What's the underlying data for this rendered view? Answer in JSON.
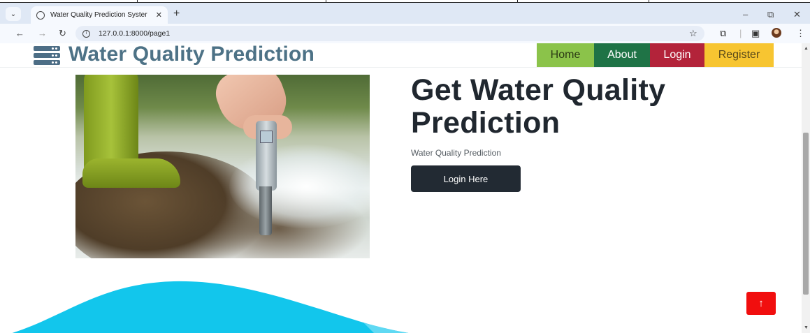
{
  "browser": {
    "tab_title": "Water Quality Prediction Syster",
    "url": "127.0.0.1:8000/page1"
  },
  "site": {
    "brand": "Water Quality Prediction",
    "nav": {
      "home": "Home",
      "about": "About",
      "login": "Login",
      "register": "Register"
    }
  },
  "hero": {
    "title": "Get Water Quality Prediction",
    "subtitle": "Water Quality Prediction",
    "button": "Login Here"
  },
  "colors": {
    "brand": "#4d7286",
    "home": "#8bc34a",
    "about": "#1f7346",
    "login": "#b3233a",
    "register": "#f7c531",
    "wave": "#12c6ec",
    "to_top": "#f10e0e"
  }
}
